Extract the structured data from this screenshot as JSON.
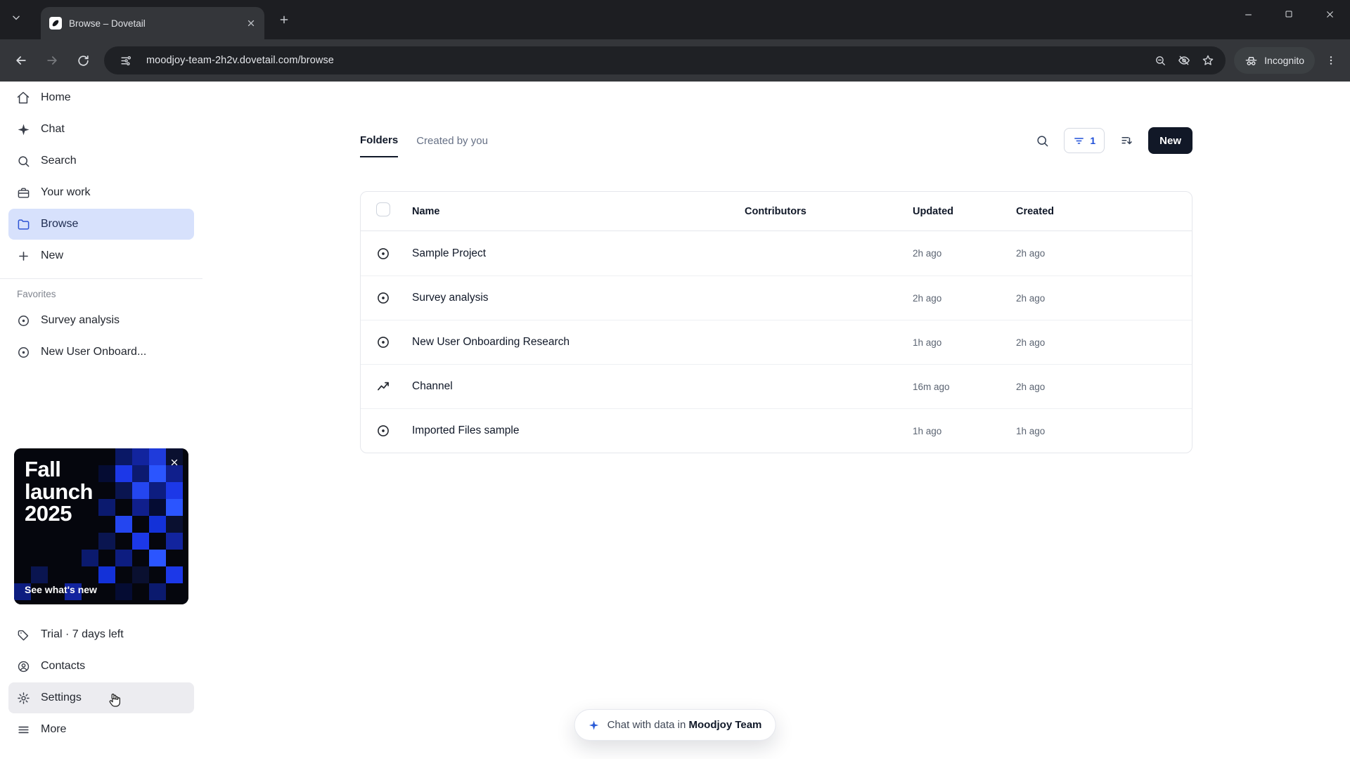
{
  "browser": {
    "tab_title": "Browse – Dovetail",
    "url": "moodjoy-team-2h2v.dovetail.com/browse",
    "incognito_label": "Incognito"
  },
  "sidebar": {
    "items": [
      {
        "label": "Home"
      },
      {
        "label": "Chat"
      },
      {
        "label": "Search"
      },
      {
        "label": "Your work"
      },
      {
        "label": "Browse"
      },
      {
        "label": "New"
      }
    ],
    "favorites_label": "Favorites",
    "favorites": [
      {
        "label": "Survey analysis"
      },
      {
        "label": "New User Onboard..."
      }
    ],
    "promo": {
      "title": "Fall launch 2025",
      "cta": "See what's new"
    },
    "footer": [
      {
        "label": "Trial · 7 days left"
      },
      {
        "label": "Contacts"
      },
      {
        "label": "Settings"
      },
      {
        "label": "More"
      }
    ]
  },
  "main": {
    "tabs": [
      {
        "label": "Folders"
      },
      {
        "label": "Created by you"
      }
    ],
    "toolbar": {
      "filter_count": "1",
      "new_label": "New"
    },
    "table": {
      "columns": {
        "name": "Name",
        "contributors": "Contributors",
        "updated": "Updated",
        "created": "Created"
      },
      "rows": [
        {
          "name": "Sample Project",
          "updated": "2h ago",
          "created": "2h ago"
        },
        {
          "name": "Survey analysis",
          "updated": "2h ago",
          "created": "2h ago"
        },
        {
          "name": "New User Onboarding Research",
          "updated": "1h ago",
          "created": "2h ago"
        },
        {
          "name": "Channel",
          "updated": "16m ago",
          "created": "2h ago"
        },
        {
          "name": "Imported Files sample",
          "updated": "1h ago",
          "created": "1h ago"
        }
      ]
    }
  },
  "chat_pill": {
    "prefix": "Chat with data in",
    "team": "Moodjoy Team"
  },
  "colors": {
    "accent_blue": "#2f55d4",
    "selected_bg": "#d7e1fc",
    "new_button_bg": "#111827",
    "promo_bg": "#05060d"
  }
}
